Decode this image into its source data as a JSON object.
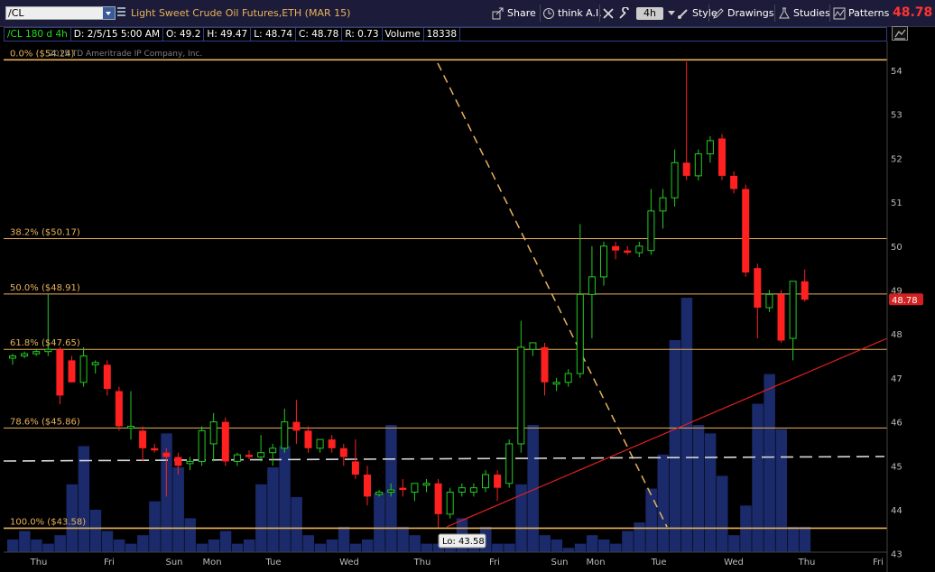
{
  "toolbar": {
    "symbol": "/CL",
    "description": "Light Sweet Crude Oil Futures,ETH (MAR 15)",
    "share_label": "Share",
    "thinkai_label": "think A.I.",
    "timeframe": "4h",
    "style_label": "Style",
    "drawings_label": "Drawings",
    "studies_label": "Studies",
    "patterns_label": "Patterns",
    "last_price": "48.78"
  },
  "infobar": {
    "title": "/CL 180 d 4h",
    "date": "D: 2/5/15 5:00 AM",
    "open": "O: 49.2",
    "high": "H: 49.47",
    "low": "L: 48.74",
    "close": "C: 48.78",
    "range": "R: 0.73",
    "volume_label": "Volume",
    "volume_value": "18338"
  },
  "copyright": "2015 TD Ameritrade IP Company, Inc.",
  "fib_levels": [
    {
      "label": "0.0%",
      "price_label": "($54.24)",
      "price": 54.24
    },
    {
      "label": "38.2%",
      "price_label": "($50.17)",
      "price": 50.17
    },
    {
      "label": "50.0%",
      "price_label": "($48.91)",
      "price": 48.91
    },
    {
      "label": "61.8%",
      "price_label": "($47.65)",
      "price": 47.65
    },
    {
      "label": "78.6%",
      "price_label": "($45.86)",
      "price": 45.86
    },
    {
      "label": "100.0%",
      "price_label": "($43.58)",
      "price": 43.58
    }
  ],
  "lo_bubble": "Lo: 43.58",
  "price_tag": "48.78",
  "colors": {
    "up": "#22cc22",
    "down": "#ff2020",
    "fib": "#e8b25a",
    "volume": "#1a2a6a",
    "trend": "#e02020"
  },
  "chart_data": {
    "type": "candlestick",
    "y_axis": {
      "ticks": [
        43,
        44,
        45,
        46,
        47,
        48,
        49,
        50,
        51,
        52,
        53,
        54
      ],
      "range": [
        43,
        54.3
      ]
    },
    "x_axis_labels": [
      "Thu",
      "Fri",
      "Sun",
      "Mon",
      "Tue",
      "Wed",
      "Thu",
      "Fri",
      "Sun",
      "Mon",
      "Tue",
      "Wed",
      "Thu",
      "Fri"
    ],
    "candles": [
      {
        "o": 47.45,
        "h": 47.55,
        "l": 47.3,
        "c": 47.5
      },
      {
        "o": 47.5,
        "h": 47.6,
        "l": 47.45,
        "c": 47.55
      },
      {
        "o": 47.55,
        "h": 47.65,
        "l": 47.5,
        "c": 47.6
      },
      {
        "o": 47.6,
        "h": 48.9,
        "l": 47.5,
        "c": 47.65
      },
      {
        "o": 47.65,
        "h": 47.7,
        "l": 46.4,
        "c": 46.6
      },
      {
        "o": 47.4,
        "h": 47.5,
        "l": 46.9,
        "c": 46.9
      },
      {
        "o": 46.9,
        "h": 47.7,
        "l": 46.8,
        "c": 47.5
      },
      {
        "o": 47.3,
        "h": 47.4,
        "l": 47.1,
        "c": 47.35
      },
      {
        "o": 47.3,
        "h": 47.4,
        "l": 46.6,
        "c": 46.75
      },
      {
        "o": 46.7,
        "h": 46.8,
        "l": 45.8,
        "c": 45.9
      },
      {
        "o": 45.9,
        "h": 46.7,
        "l": 45.6,
        "c": 45.9
      },
      {
        "o": 45.8,
        "h": 45.9,
        "l": 45.1,
        "c": 45.4
      },
      {
        "o": 45.4,
        "h": 45.5,
        "l": 45.3,
        "c": 45.35
      },
      {
        "o": 45.3,
        "h": 45.4,
        "l": 44.3,
        "c": 45.2
      },
      {
        "o": 45.2,
        "h": 45.3,
        "l": 44.8,
        "c": 45.0
      },
      {
        "o": 45.05,
        "h": 45.2,
        "l": 44.9,
        "c": 45.1
      },
      {
        "o": 45.1,
        "h": 45.9,
        "l": 45.0,
        "c": 45.8
      },
      {
        "o": 45.5,
        "h": 46.2,
        "l": 45.1,
        "c": 46.0
      },
      {
        "o": 46.0,
        "h": 46.1,
        "l": 45.0,
        "c": 45.1
      },
      {
        "o": 45.1,
        "h": 45.3,
        "l": 45.0,
        "c": 45.25
      },
      {
        "o": 45.25,
        "h": 45.35,
        "l": 45.15,
        "c": 45.2
      },
      {
        "o": 45.2,
        "h": 45.7,
        "l": 45.1,
        "c": 45.3
      },
      {
        "o": 45.3,
        "h": 45.5,
        "l": 45.0,
        "c": 45.4
      },
      {
        "o": 45.4,
        "h": 46.3,
        "l": 45.3,
        "c": 46.0
      },
      {
        "o": 46.0,
        "h": 46.5,
        "l": 45.5,
        "c": 45.8
      },
      {
        "o": 45.8,
        "h": 45.9,
        "l": 45.3,
        "c": 45.4
      },
      {
        "o": 45.4,
        "h": 45.6,
        "l": 45.3,
        "c": 45.6
      },
      {
        "o": 45.6,
        "h": 45.7,
        "l": 45.3,
        "c": 45.4
      },
      {
        "o": 45.4,
        "h": 45.5,
        "l": 45.0,
        "c": 45.2
      },
      {
        "o": 45.1,
        "h": 45.6,
        "l": 44.7,
        "c": 44.8
      },
      {
        "o": 44.8,
        "h": 45.0,
        "l": 44.1,
        "c": 44.3
      },
      {
        "o": 44.35,
        "h": 44.45,
        "l": 44.3,
        "c": 44.4
      },
      {
        "o": 44.4,
        "h": 44.6,
        "l": 44.3,
        "c": 44.45
      },
      {
        "o": 44.5,
        "h": 44.7,
        "l": 44.3,
        "c": 44.45
      },
      {
        "o": 44.4,
        "h": 44.6,
        "l": 44.2,
        "c": 44.6
      },
      {
        "o": 44.6,
        "h": 44.7,
        "l": 44.4,
        "c": 44.6
      },
      {
        "o": 44.6,
        "h": 44.7,
        "l": 43.6,
        "c": 43.9
      },
      {
        "o": 43.9,
        "h": 44.5,
        "l": 43.8,
        "c": 44.4
      },
      {
        "o": 44.4,
        "h": 44.6,
        "l": 44.3,
        "c": 44.5
      },
      {
        "o": 44.4,
        "h": 44.6,
        "l": 44.3,
        "c": 44.5
      },
      {
        "o": 44.5,
        "h": 44.9,
        "l": 44.4,
        "c": 44.8
      },
      {
        "o": 44.8,
        "h": 44.9,
        "l": 44.2,
        "c": 44.5
      },
      {
        "o": 44.6,
        "h": 45.6,
        "l": 44.5,
        "c": 45.5
      },
      {
        "o": 45.5,
        "h": 48.3,
        "l": 45.3,
        "c": 47.7
      },
      {
        "o": 47.65,
        "h": 47.8,
        "l": 47.5,
        "c": 47.8
      },
      {
        "o": 47.7,
        "h": 47.8,
        "l": 46.6,
        "c": 46.9
      },
      {
        "o": 46.9,
        "h": 47.0,
        "l": 46.7,
        "c": 46.9
      },
      {
        "o": 46.9,
        "h": 47.2,
        "l": 46.8,
        "c": 47.1
      },
      {
        "o": 47.1,
        "h": 50.5,
        "l": 47.0,
        "c": 48.9
      },
      {
        "o": 48.9,
        "h": 50.0,
        "l": 47.9,
        "c": 49.3
      },
      {
        "o": 49.3,
        "h": 50.1,
        "l": 49.1,
        "c": 50.0
      },
      {
        "o": 50.0,
        "h": 50.1,
        "l": 49.7,
        "c": 49.9
      },
      {
        "o": 49.9,
        "h": 50.0,
        "l": 49.8,
        "c": 49.85
      },
      {
        "o": 49.85,
        "h": 50.1,
        "l": 49.75,
        "c": 50.0
      },
      {
        "o": 49.9,
        "h": 51.3,
        "l": 49.8,
        "c": 50.8
      },
      {
        "o": 50.8,
        "h": 51.3,
        "l": 50.4,
        "c": 51.1
      },
      {
        "o": 51.1,
        "h": 52.2,
        "l": 50.9,
        "c": 51.9
      },
      {
        "o": 51.9,
        "h": 54.2,
        "l": 51.5,
        "c": 51.6
      },
      {
        "o": 51.6,
        "h": 52.2,
        "l": 51.5,
        "c": 52.1
      },
      {
        "o": 52.1,
        "h": 52.5,
        "l": 51.9,
        "c": 52.4
      },
      {
        "o": 52.45,
        "h": 52.55,
        "l": 51.5,
        "c": 51.6
      },
      {
        "o": 51.6,
        "h": 51.7,
        "l": 51.2,
        "c": 51.3
      },
      {
        "o": 51.3,
        "h": 51.4,
        "l": 49.3,
        "c": 49.4
      },
      {
        "o": 49.5,
        "h": 49.6,
        "l": 47.9,
        "c": 48.6
      },
      {
        "o": 48.6,
        "h": 49.0,
        "l": 48.5,
        "c": 48.9
      },
      {
        "o": 48.9,
        "h": 49.0,
        "l": 47.8,
        "c": 47.85
      },
      {
        "o": 47.9,
        "h": 49.2,
        "l": 47.4,
        "c": 49.2
      },
      {
        "o": 49.2,
        "h": 49.47,
        "l": 48.74,
        "c": 48.78
      }
    ],
    "volume": [
      3,
      5,
      3,
      2,
      4,
      16,
      25,
      10,
      5,
      3,
      2,
      4,
      12,
      28,
      20,
      8,
      2,
      3,
      5,
      2,
      3,
      16,
      20,
      25,
      13,
      4,
      2,
      3,
      6,
      2,
      3,
      14,
      30,
      6,
      4,
      2,
      2,
      4,
      8,
      3,
      6,
      2,
      2,
      16,
      30,
      4,
      3,
      1,
      2,
      4,
      3,
      2,
      5,
      7,
      15,
      23,
      50,
      60,
      30,
      28,
      18,
      4,
      11,
      35,
      42,
      29,
      6,
      6
    ]
  }
}
